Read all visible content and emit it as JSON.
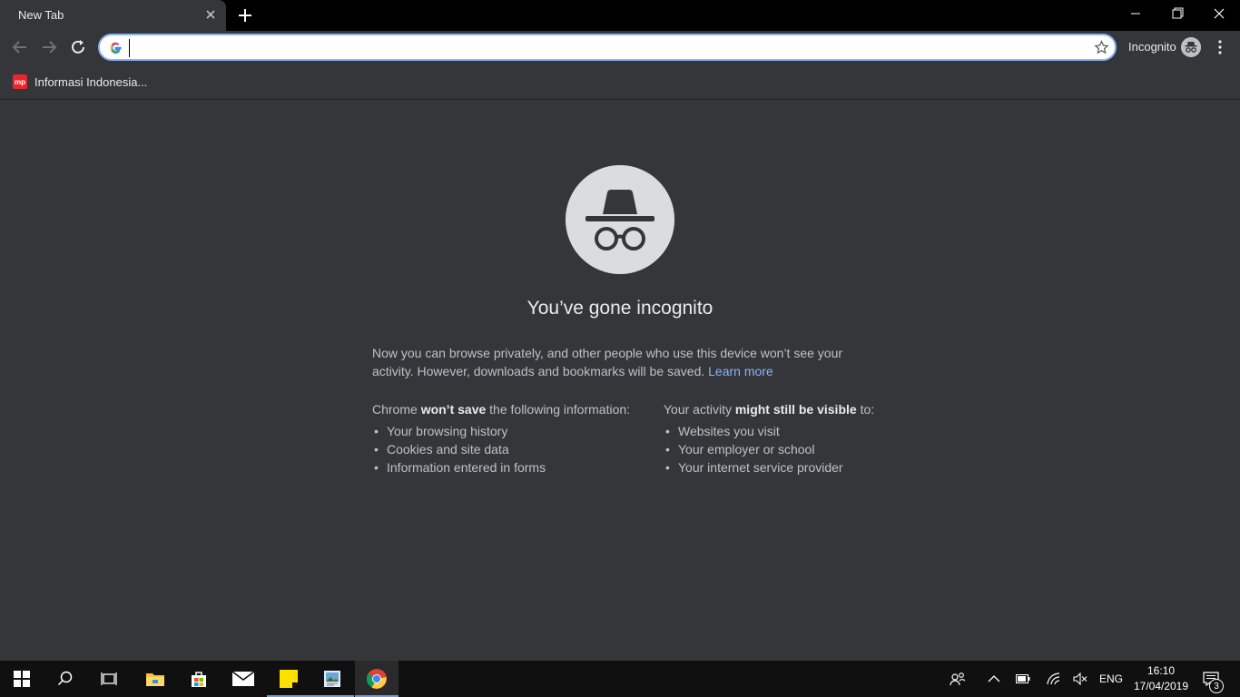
{
  "tab": {
    "title": "New Tab"
  },
  "omnibox": {
    "value": "",
    "placeholder": ""
  },
  "profile": {
    "label": "Incognito"
  },
  "bookmarks": [
    {
      "favicon_text": "mp",
      "label": "Informasi Indonesia..."
    }
  ],
  "page": {
    "heading": "You’ve gone incognito",
    "intro": "Now you can browse privately, and other people who use this device won’t see your activity. However, downloads and bookmarks will be saved.",
    "learn_more": "Learn more",
    "left": {
      "prefix": "Chrome",
      "bold": "won’t save",
      "suffix": "the following information:",
      "items": [
        "Your browsing history",
        "Cookies and site data",
        "Information entered in forms"
      ]
    },
    "right": {
      "prefix": "Your activity",
      "bold": "might still be visible",
      "suffix": "to:",
      "items": [
        "Websites you visit",
        "Your employer or school",
        "Your internet service provider"
      ]
    }
  },
  "taskbar": {
    "language": "ENG",
    "time": "16:10",
    "date": "17/04/2019",
    "notifications": "3"
  },
  "colors": {
    "accent": "#8ab4f8",
    "background": "#35363a"
  }
}
